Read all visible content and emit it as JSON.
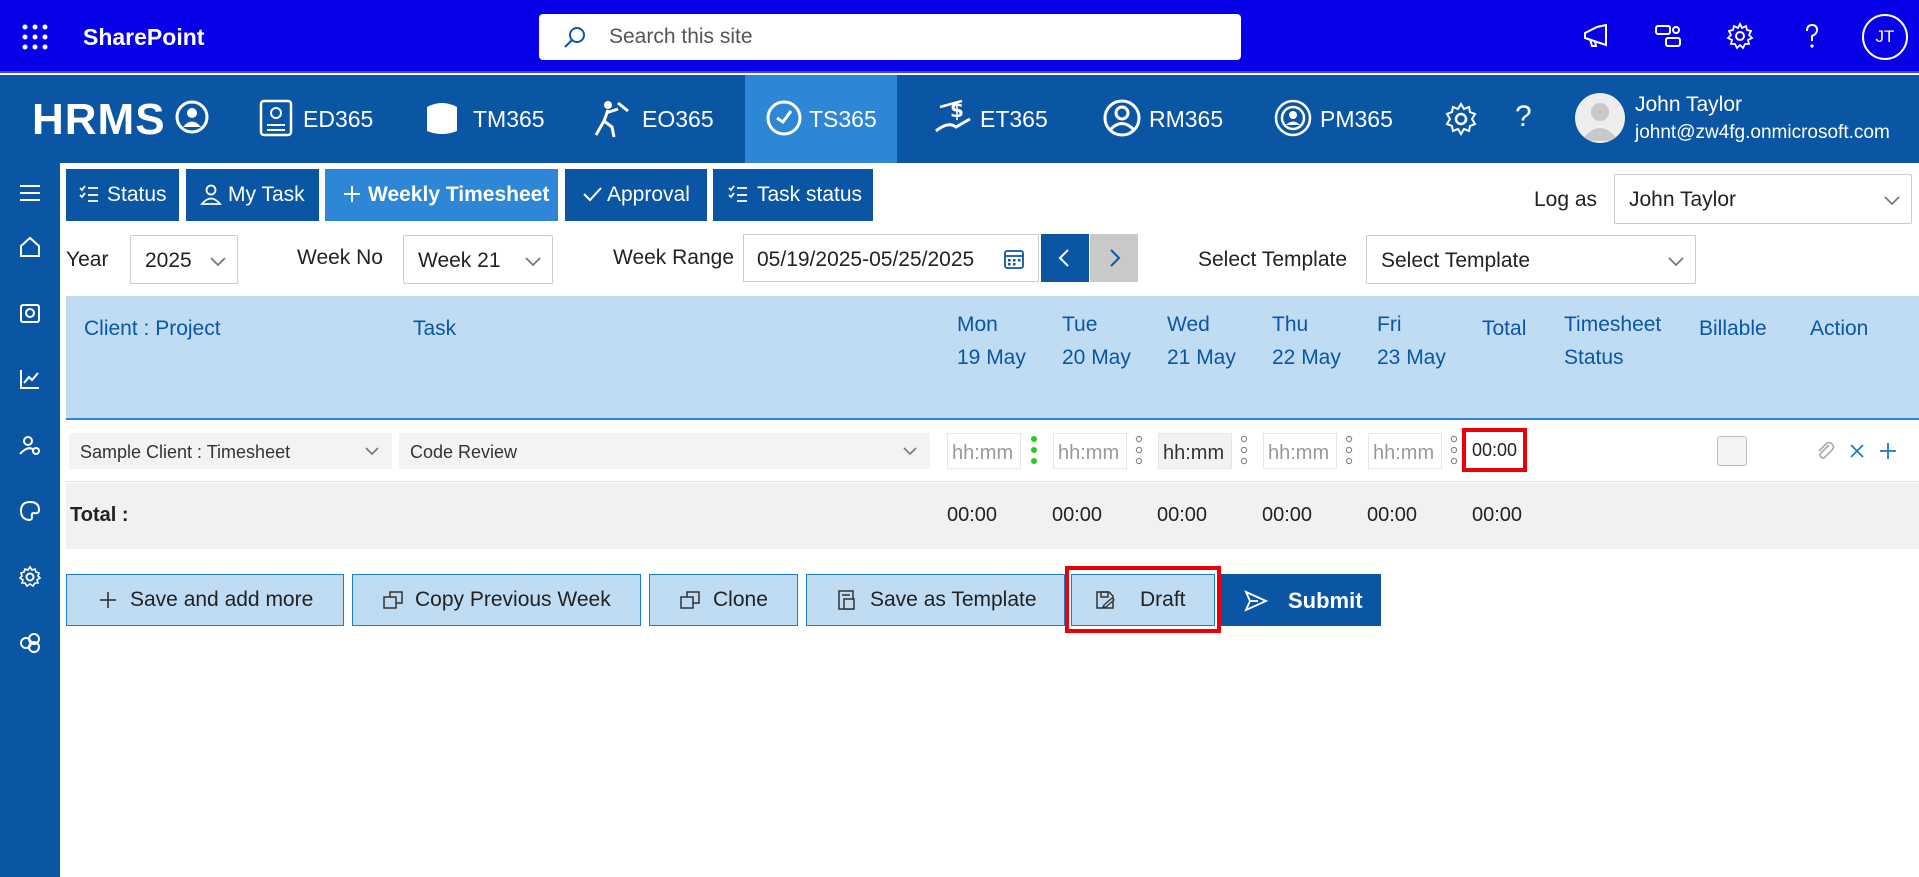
{
  "sharepoint": {
    "title": "SharePoint",
    "search_placeholder": "Search this site",
    "avatar_initials": "JT"
  },
  "hrms": {
    "logo": "HRMS",
    "modules": [
      {
        "label": "ED365",
        "icon": "id-badge-icon",
        "active": false
      },
      {
        "label": "TM365",
        "icon": "map-icon",
        "active": false
      },
      {
        "label": "EO365",
        "icon": "onboarding-icon",
        "active": false
      },
      {
        "label": "TS365",
        "icon": "clock-icon",
        "active": true
      },
      {
        "label": "ET365",
        "icon": "expense-icon",
        "active": false
      },
      {
        "label": "RM365",
        "icon": "recruit-icon",
        "active": false
      },
      {
        "label": "PM365",
        "icon": "performance-icon",
        "active": false
      }
    ],
    "user": {
      "name": "John Taylor",
      "email": "johnt@zw4fg.onmicrosoft.com"
    }
  },
  "tabs": [
    {
      "label": "Status",
      "active": false
    },
    {
      "label": "My Task",
      "active": false
    },
    {
      "label": "Weekly Timesheet",
      "active": true
    },
    {
      "label": "Approval",
      "active": false
    },
    {
      "label": "Task status",
      "active": false
    }
  ],
  "log_as": {
    "label": "Log as",
    "value": "John Taylor"
  },
  "filters": {
    "year_label": "Year",
    "year_value": "2025",
    "week_no_label": "Week No",
    "week_no_value": "Week 21",
    "week_range_label": "Week Range",
    "week_range_value": "05/19/2025-05/25/2025",
    "template_label": "Select Template",
    "template_value": "Select Template"
  },
  "table": {
    "headers": {
      "client_project": "Client : Project",
      "task": "Task",
      "days": [
        {
          "day": "Mon",
          "date": "19 May"
        },
        {
          "day": "Tue",
          "date": "20 May"
        },
        {
          "day": "Wed",
          "date": "21 May"
        },
        {
          "day": "Thu",
          "date": "22 May"
        },
        {
          "day": "Fri",
          "date": "23 May"
        }
      ],
      "total": "Total",
      "timesheet_status_1": "Timesheet",
      "timesheet_status_2": "Status",
      "billable": "Billable",
      "action": "Action"
    },
    "row": {
      "client_project": "Sample Client : Timesheet",
      "task": "Code Review",
      "hours_placeholder": "hh:mm",
      "total": "00:00"
    },
    "totals": {
      "label": "Total :",
      "days": [
        "00:00",
        "00:00",
        "00:00",
        "00:00",
        "00:00"
      ],
      "total": "00:00"
    }
  },
  "actions": {
    "save_and_add_more": "Save and add more",
    "copy_previous_week": "Copy Previous Week",
    "clone": "Clone",
    "save_as_template": "Save as Template",
    "draft": "Draft",
    "submit": "Submit"
  },
  "colors": {
    "sharepoint_bar": "#0800e8",
    "hrms_bar": "#0b56a4",
    "active_tab": "#2d86d6",
    "table_header": "#bfdcf3",
    "highlight": "#e8000b"
  }
}
